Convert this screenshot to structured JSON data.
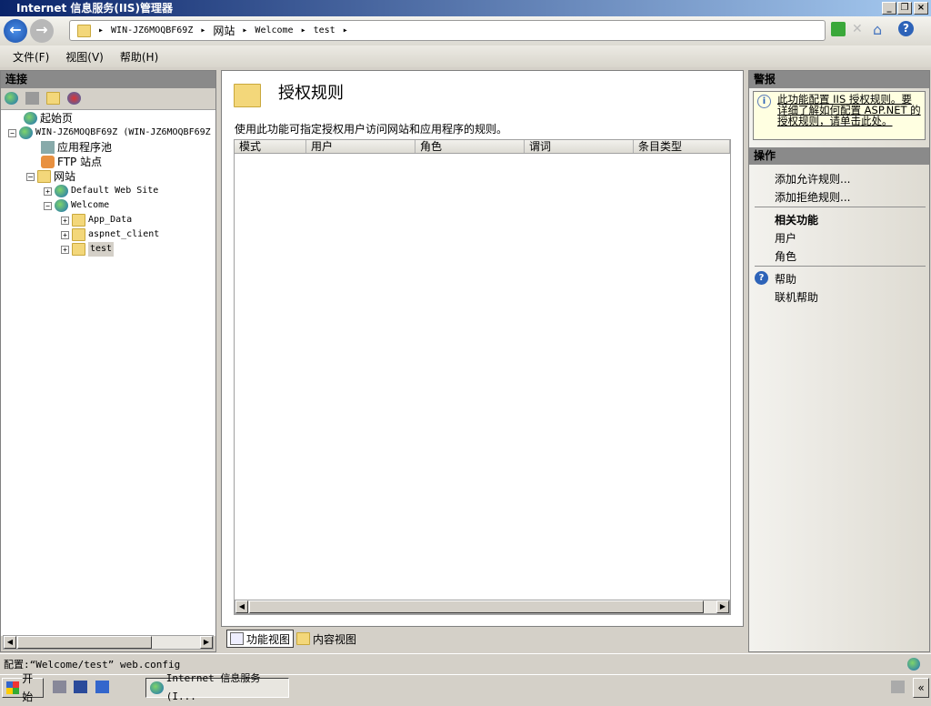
{
  "window": {
    "title": "Internet 信息服务(IIS)管理器",
    "minimize": "_",
    "restore": "❐",
    "close": "×"
  },
  "nav": {
    "back": "←",
    "forward": "→",
    "breadcrumb": [
      "WIN-JZ6MOQBF69Z",
      "网站",
      "Welcome",
      "test"
    ],
    "separator": "▸"
  },
  "menu": [
    "文件(F)",
    "视图(V)",
    "帮助(H)"
  ],
  "connections": {
    "header": "连接",
    "tree": [
      {
        "label": "起始页",
        "level": 0
      },
      {
        "label": "WIN-JZ6MOQBF69Z (WIN-JZ6MOQBF69Z",
        "level": 0,
        "expanded": true
      },
      {
        "label": "应用程序池",
        "level": 1
      },
      {
        "label": "FTP 站点",
        "level": 1
      },
      {
        "label": "网站",
        "level": 1,
        "expanded": true
      },
      {
        "label": "Default Web Site",
        "level": 2,
        "expanded": false
      },
      {
        "label": "Welcome",
        "level": 2,
        "expanded": true
      },
      {
        "label": "App_Data",
        "level": 3,
        "expanded": false
      },
      {
        "label": "aspnet_client",
        "level": 3,
        "expanded": false
      },
      {
        "label": "test",
        "level": 3,
        "expanded": false,
        "selected": true
      }
    ]
  },
  "main": {
    "title": "授权规则",
    "description": "使用此功能可指定授权用户访问网站和应用程序的规则。",
    "columns": [
      "模式",
      "用户",
      "角色",
      "谓词",
      "条目类型"
    ],
    "rows": [],
    "tabs": [
      {
        "label": "功能视图",
        "active": true
      },
      {
        "label": "内容视图",
        "active": false
      }
    ]
  },
  "alerts": {
    "header": "警报",
    "text": "此功能配置 IIS 授权规则。要详细了解如何配置 ASP.NET 的授权规则，请单击此处。"
  },
  "actions": {
    "header": "操作",
    "items": [
      "添加允许规则...",
      "添加拒绝规则..."
    ],
    "related_header": "相关功能",
    "related": [
      "用户",
      "角色"
    ],
    "help": "帮助",
    "online_help": "联机帮助"
  },
  "status": {
    "text": "配置:“Welcome/test” web.config"
  },
  "taskbar": {
    "start": "开始",
    "task": "Internet 信息服务(I..."
  },
  "colors": {
    "title_start": "#0a246a",
    "title_end": "#a6caf0",
    "alert_bg": "#ffffe1",
    "panel_header": "#8a8a8a"
  }
}
